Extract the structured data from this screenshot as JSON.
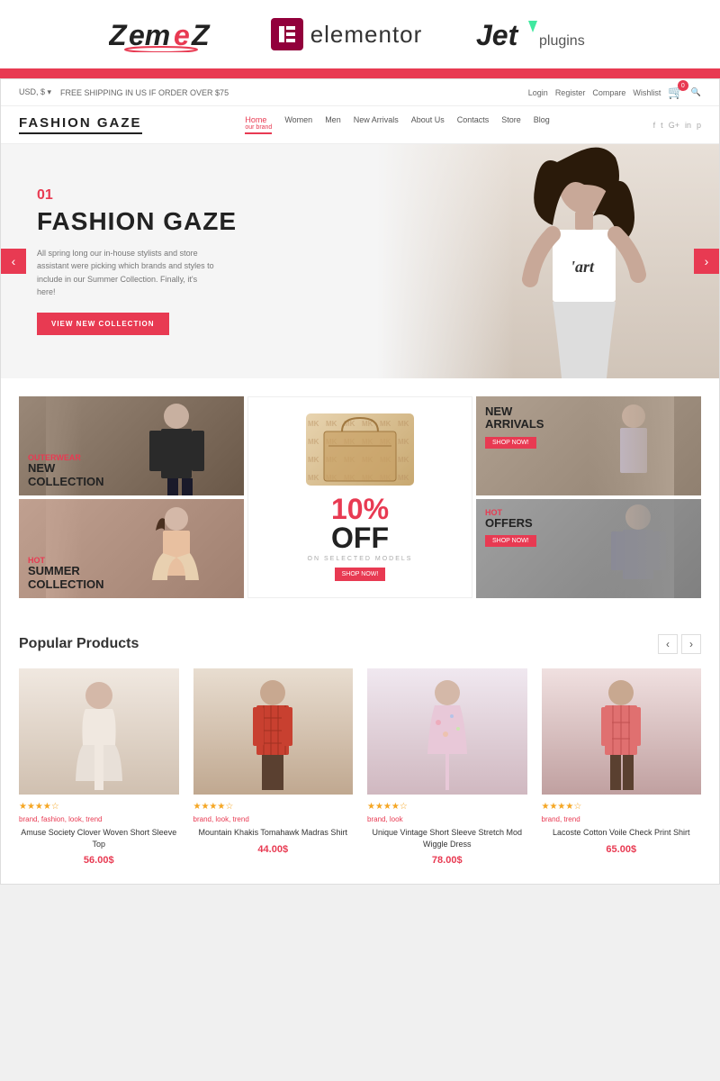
{
  "brand_bar": {
    "zemes": "ZEmeZ",
    "elementor": "elementor",
    "jetplugins": "JETplugins"
  },
  "site": {
    "topbar": {
      "currency": "USD, $ ▾",
      "shipping": "FREE SHIPPING IN US IF ORDER OVER $75",
      "links": [
        "Login",
        "Register",
        "Compare",
        "Wishlist"
      ],
      "cart_count": "0"
    },
    "logo": "FASHION GAZE",
    "nav": {
      "items": [
        {
          "label": "Home",
          "active": true
        },
        {
          "label": "Women",
          "active": false
        },
        {
          "label": "Men",
          "active": false
        },
        {
          "label": "New Arrivals",
          "active": false
        },
        {
          "label": "About Us",
          "active": false
        },
        {
          "label": "Contacts",
          "active": false
        },
        {
          "label": "Store",
          "active": false
        },
        {
          "label": "Blog",
          "active": false
        }
      ],
      "nav_sub": "our brand"
    },
    "social": [
      "f",
      "t",
      "G+",
      "in",
      "🔗"
    ],
    "hero": {
      "number": "01",
      "title": "FASHION GAZE",
      "description": "All spring long our in-house stylists and store assistant were picking which brands and styles to include in our Summer Collection. Finally, it's here!",
      "button": "VIEW NEW COLLECTION"
    },
    "promo": {
      "outerwear": {
        "tag": "OUTERWEAR",
        "main": "NEW\nCOLLECTION"
      },
      "discount": {
        "percent": "10%",
        "off": "OFF",
        "subtitle": "ON SELECTED MODELS",
        "button": "SHOP NOW!"
      },
      "new_arrivals": {
        "tag": "NEW\nARRIVALS",
        "button": "SHOP NOW!"
      },
      "hot_summer": {
        "tag": "HOT",
        "main": "SUMMER\nCOLLECTION"
      },
      "hot_offers": {
        "tag": "HOT",
        "main": "OFFERS",
        "button": "SHOP NOW!"
      }
    },
    "popular": {
      "title": "Popular Products",
      "products": [
        {
          "stars": "★★★★☆",
          "tags": "brand, fashion, look, trend",
          "name": "Amuse Society Clover Woven Short Sleeve Top",
          "price": "56.00$"
        },
        {
          "stars": "★★★★☆",
          "tags": "brand, look, trend",
          "name": "Mountain Khakis Tomahawk Madras Shirt",
          "price": "44.00$"
        },
        {
          "stars": "★★★★☆",
          "tags": "brand, look",
          "name": "Unique Vintage Short Sleeve Stretch Mod Wiggle Dress",
          "price": "78.00$"
        },
        {
          "stars": "★★★★☆",
          "tags": "brand, trend",
          "name": "Lacoste Cotton Voile Check Print Shirt",
          "price": "65.00$"
        }
      ]
    }
  }
}
